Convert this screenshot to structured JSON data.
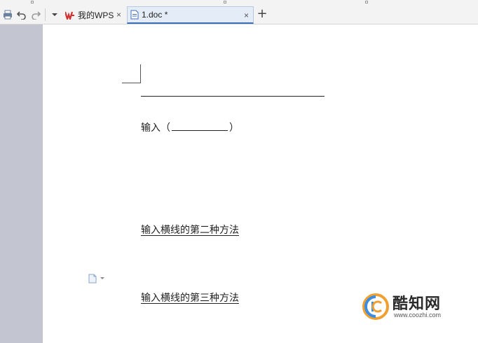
{
  "tabs": [
    {
      "label": "我的WPS",
      "close": "×"
    },
    {
      "label": "1.doc *",
      "close": "×"
    }
  ],
  "new_tab": "+",
  "document": {
    "input_prefix": "输入（",
    "input_suffix": "）",
    "line2": "输入横线的第二种方法",
    "line3": "输入横线的第三种方法"
  },
  "watermark": {
    "title": "酷知网",
    "url": "www.coozhi.com"
  },
  "colors": {
    "wps_red": "#d32f2f",
    "sidebar": "#c3c5d0",
    "active_tab_border": "#3d6fb6"
  }
}
